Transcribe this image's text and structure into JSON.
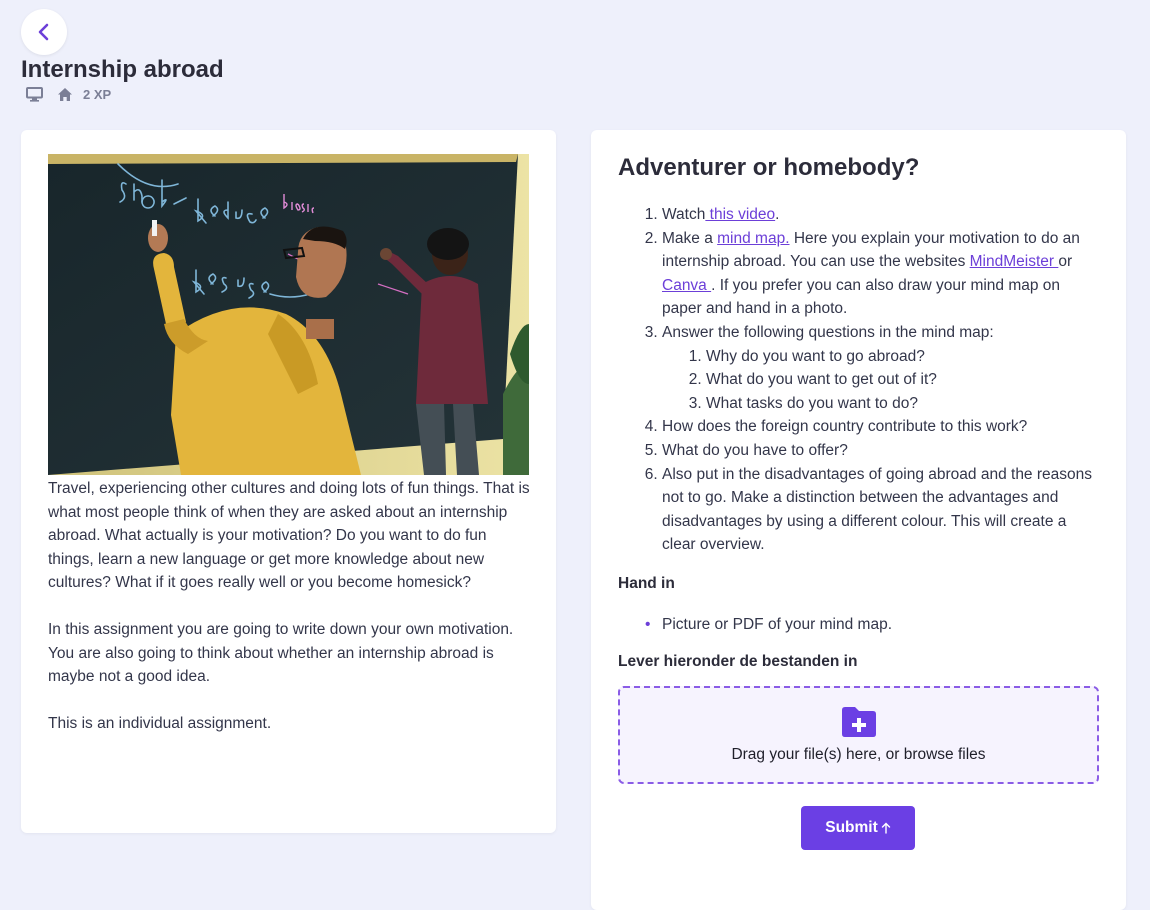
{
  "header": {
    "title": "Internship abroad",
    "xp": "2 XP",
    "icons": [
      "back-chevron-icon",
      "desktop-icon",
      "home-icon"
    ]
  },
  "left": {
    "image_alt": "Two students writing on a chalkboard",
    "paragraphs": [
      "Travel, experiencing other cultures and doing lots of fun things. That is what most people think of when they are asked about an internship abroad. What actually is your motivation? Do you want to do fun things, learn a new language or get more knowledge about new cultures? What if it goes really well or you become homesick?",
      "In this assignment you are going to write down your own motivation. You are also going to think about whether an internship abroad is maybe not a good idea.",
      "This is an individual assignment."
    ]
  },
  "right": {
    "title": "Adventurer or homebody?",
    "steps": {
      "s1_pre": "Watch",
      "s1_link": " this video",
      "s1_post": ".",
      "s2_pre": "Make a ",
      "s2_link": "mind map.",
      "s2_mid": " Here you explain your motivation to do an internship abroad. You can use the websites ",
      "s2_link2": "MindMeister ",
      "s2_or": " or ",
      "s2_link3": "Canva ",
      "s2_post": ". If you prefer you can also draw your mind map on paper and hand in a photo.",
      "s3": "Answer the following questions in the mind map:",
      "s3_sub": [
        "Why do you want to go abroad?",
        "What do you want to get out of it?",
        "What tasks do you want to do?"
      ],
      "s4": "How does the foreign country contribute to this work?",
      "s5": "What do you have to offer?",
      "s6": "Also put in the disadvantages of going abroad and the reasons not to go. Make a distinction between the advantages and disadvantages by using a different colour. This will create a clear overview."
    },
    "hand_in_heading": "Hand in",
    "hand_in_items": [
      "Picture or PDF of your mind map."
    ],
    "upload_heading": "Lever hieronder de bestanden in",
    "dropzone_text": "Drag your file(s) here, or browse files",
    "submit_label": "Submit",
    "accent": "#6b3fe4"
  }
}
